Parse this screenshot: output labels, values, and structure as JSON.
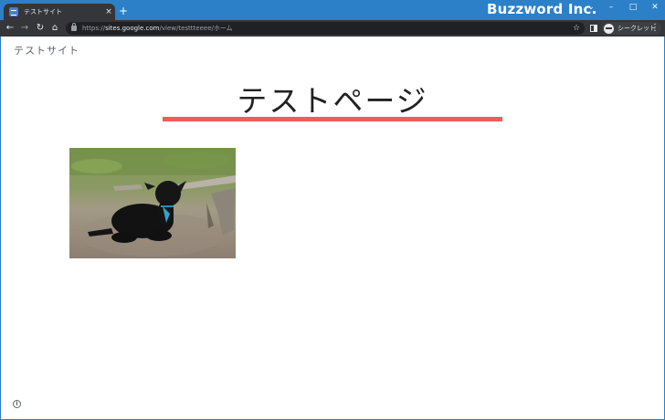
{
  "browser": {
    "tab": {
      "title": "テストサイト",
      "close": "×"
    },
    "new_tab": "+",
    "brand": "Buzzword Inc.",
    "window_controls": {
      "collapse": "⌄",
      "minimize": "–",
      "maximize": "□",
      "close": "✕"
    },
    "nav": {
      "back": "←",
      "forward": "→",
      "reload": "↻",
      "home": "⌂"
    },
    "address": {
      "scheme": "https://",
      "host": "sites.google.com",
      "path": "/view/testtteeee/ホーム"
    },
    "bookmark_star": "☆",
    "incognito_label": "シークレット",
    "menu": "⋮"
  },
  "site": {
    "name": "テストサイト",
    "page_title": "テストページ",
    "accent_color": "#f45a58",
    "image_icon": "black-lamb-photo",
    "info": "i"
  }
}
